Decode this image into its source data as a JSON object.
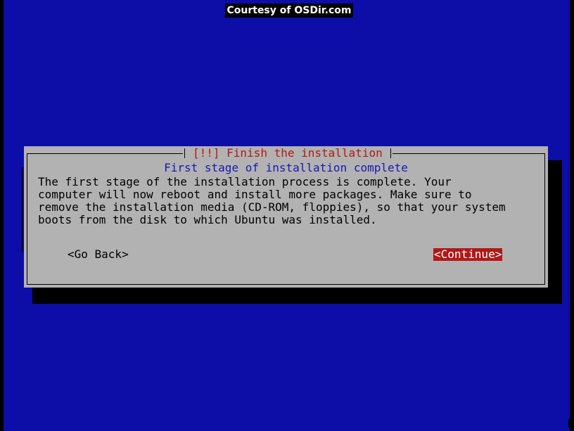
{
  "watermark": "Courtesy of OSDir.com",
  "dialog": {
    "title": "[!!] Finish the installation",
    "subtitle": "First stage of installation complete",
    "body_lines": [
      "The first stage of the installation process is complete. Your",
      "computer will now reboot and install more packages. Make sure to",
      "remove the installation media (CD-ROM, floppies), so that your system",
      "boots from the disk to which Ubuntu was installed."
    ],
    "buttons": {
      "back": "<Go Back>",
      "continue": "<Continue>"
    }
  },
  "colors": {
    "screen_background": "#0d0da8",
    "dialog_background": "#b2b2b2",
    "title_text": "#b21818",
    "subtitle_text": "#1818b2",
    "selected_button_background": "#b21818",
    "selected_button_text": "#ffffff"
  }
}
